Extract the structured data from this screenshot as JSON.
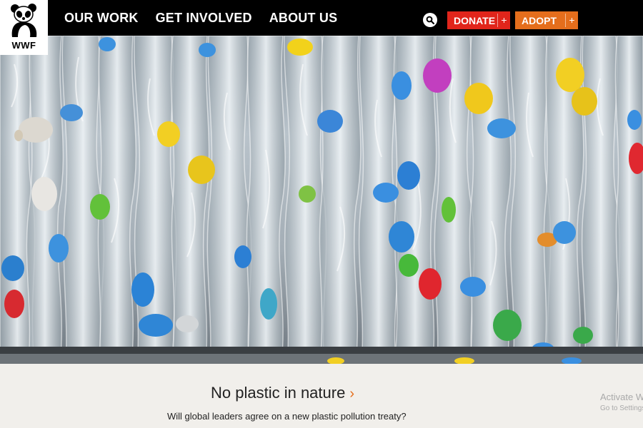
{
  "logo": {
    "text": "WWF",
    "icon": "panda-icon"
  },
  "nav": {
    "items": [
      "OUR WORK",
      "GET INVOLVED",
      "ABOUT US"
    ]
  },
  "search": {
    "icon": "search-icon"
  },
  "donate": {
    "label": "DONATE",
    "plus": "+",
    "color": "#e1251b"
  },
  "adopt": {
    "label": "ADOPT",
    "plus": "+",
    "color": "#e56e1c"
  },
  "hero": {
    "subject": "compressed-plastic-bottles-photo"
  },
  "story": {
    "headline": "No plastic in nature",
    "chevron": "›",
    "subheadline": "Will global leaders agree on a new plastic pollution treaty?"
  },
  "watermark": {
    "line1": "Activate Windows",
    "line2": "Go to Settings to activate Windows."
  }
}
